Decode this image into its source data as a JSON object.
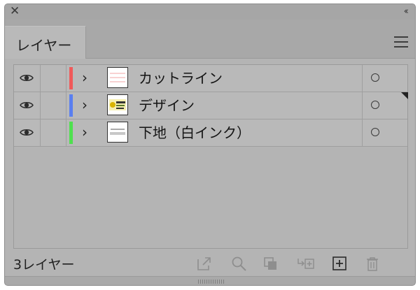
{
  "window": {
    "close_glyph": "✕",
    "collapse_glyph": "‹‹"
  },
  "tab": {
    "label": "レイヤー"
  },
  "layers": [
    {
      "name": "カットライン",
      "color": "#f05a5a",
      "thumb": "cutline-thumbnail",
      "selected": false
    },
    {
      "name": "デザイン",
      "color": "#5a7ff0",
      "thumb": "design-thumbnail",
      "selected": true
    },
    {
      "name": "下地（白インク）",
      "color": "#4fe04f",
      "thumb": "underlay-thumbnail",
      "selected": false
    }
  ],
  "footer": {
    "count_label": "3レイヤー"
  },
  "icons": {
    "visibility": "eye-icon",
    "expand": "chevron-right-icon",
    "target": "target-circle-icon",
    "tools": [
      "export-icon",
      "search-icon",
      "clipping-mask-icon",
      "move-to-layer-icon",
      "new-layer-icon",
      "delete-icon"
    ]
  }
}
